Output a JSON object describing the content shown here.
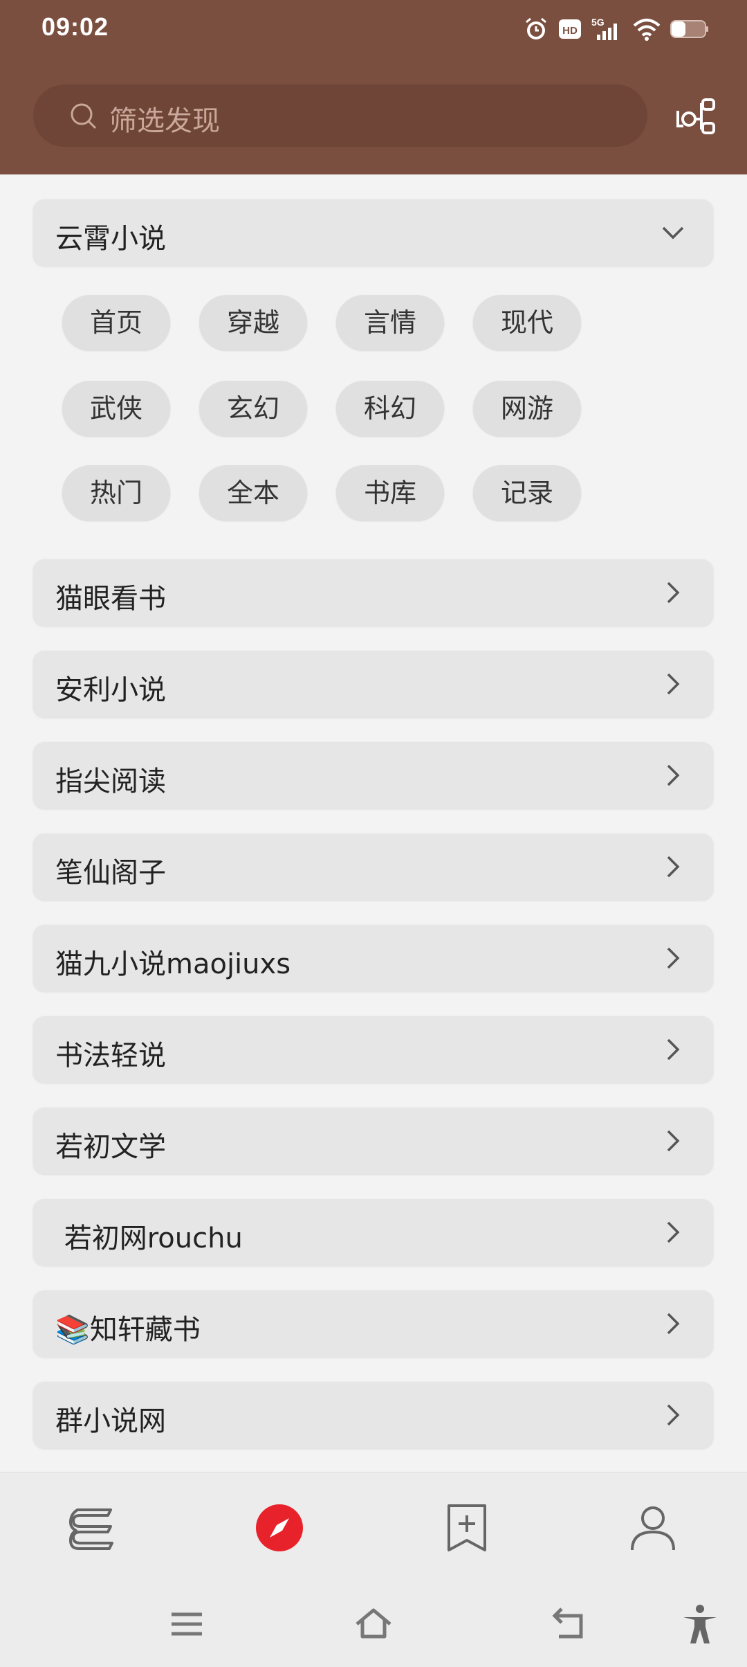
{
  "status_bar": {
    "time": "09:02",
    "icons": [
      "alarm-icon",
      "hd-icon",
      "signal-5g-icon",
      "wifi-icon",
      "battery-icon"
    ],
    "hd_label": "HD",
    "network_label": "5G"
  },
  "header": {
    "search_placeholder": "筛选发现",
    "background": "#7b4f3f"
  },
  "expanded_source": {
    "name": "云霄小说",
    "tags": [
      "首页",
      "穿越",
      "言情",
      "现代",
      "武侠",
      "玄幻",
      "科幻",
      "网游",
      "热门",
      "全本",
      "书库",
      "记录"
    ]
  },
  "sources": [
    {
      "name": "猫眼看书"
    },
    {
      "name": "安利小说"
    },
    {
      "name": "指尖阅读"
    },
    {
      "name": "笔仙阁子"
    },
    {
      "name": "猫九小说maojiuxs"
    },
    {
      "name": "书法轻说"
    },
    {
      "name": "若初文学"
    },
    {
      "name": " 若初网rouchu"
    },
    {
      "name": "知轩藏书",
      "emoji": "📚"
    },
    {
      "name": "群小说网"
    }
  ],
  "bottom_nav": {
    "items": [
      "bookshelf-icon",
      "discover-icon",
      "bookmark-add-icon",
      "profile-icon"
    ],
    "active_color": "#e8222a"
  },
  "system_nav": [
    "menu-icon",
    "home-icon",
    "back-icon",
    "accessibility-icon"
  ]
}
